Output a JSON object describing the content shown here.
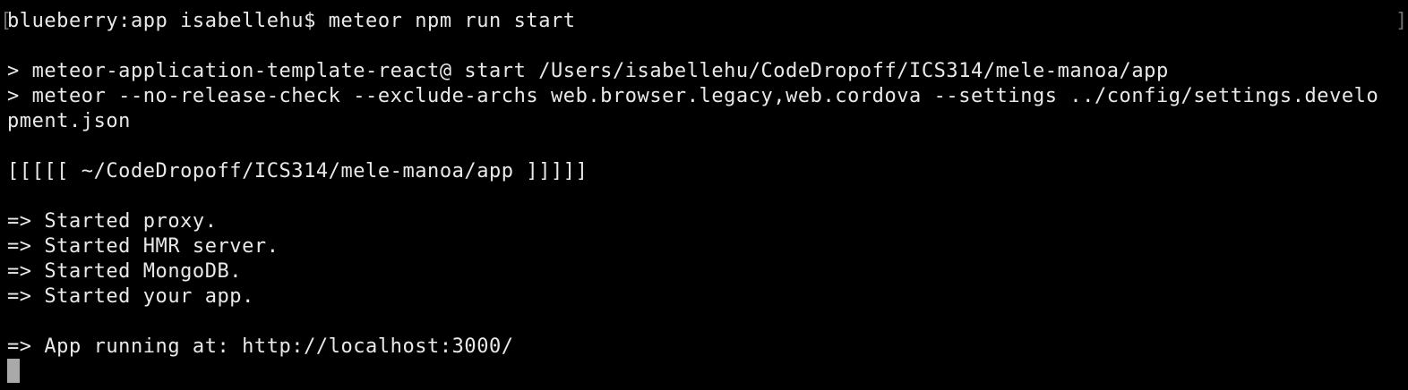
{
  "terminal": {
    "lines": [
      "blueberry:app isabellehu$ meteor npm run start",
      "",
      "> meteor-application-template-react@ start /Users/isabellehu/CodeDropoff/ICS314/mele-manoa/app",
      "> meteor --no-release-check --exclude-archs web.browser.legacy,web.cordova --settings ../config/settings.develo",
      "pment.json",
      "",
      "[[[[[ ~/CodeDropoff/ICS314/mele-manoa/app ]]]]]",
      "",
      "=> Started proxy.",
      "=> Started HMR server.",
      "=> Started MongoDB.",
      "=> Started your app.",
      "",
      "=> App running at: http://localhost:3000/"
    ],
    "left_marker": "[",
    "right_marker": "]",
    "colors": {
      "background": "#000000",
      "foreground": "#e9e9e9",
      "cursor": "#a9a9a9",
      "marker": "#6e6e6e"
    }
  }
}
